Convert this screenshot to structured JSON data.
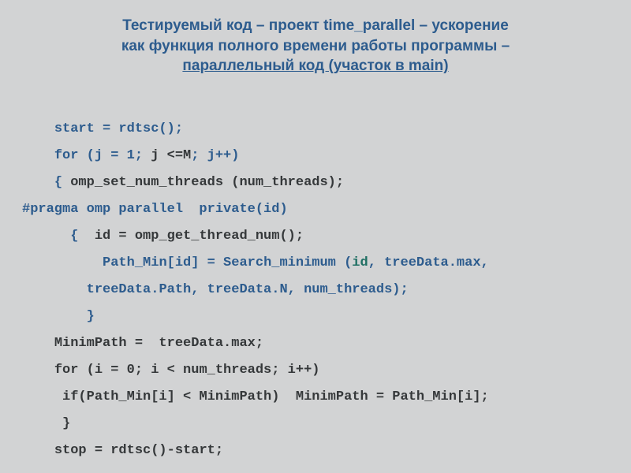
{
  "title": {
    "line1": "Тестируемый код – проект time_parallel – ускорение",
    "line2": "как функция полного времени работы программы –",
    "line3": "параллельный код (участок в main)"
  },
  "code": {
    "in1": "    ",
    "in2": "      ",
    "in3": "        ",
    "in4": "          ",
    "l1a": "start = rdtsc();",
    "l2a": "for (j = 1;",
    "l2b": " j <=M",
    "l2c": "; j++)",
    "l3a": "{",
    "l3b": " omp_set_num_threads (num_threads);",
    "l4a": "#pragma omp parallel  private(id)",
    "l5a": "{ ",
    "l5b": " id = omp_get_thread_num();",
    "l6a": "Path_Min[id] = Search_minimum (",
    "l6b": "id",
    "l6c": ", treeData.max,",
    "l7a": "treeData.Path, treeData.N, num_threads);",
    "l8a": "}",
    "l9a": "MinimPath =  treeData.max;",
    "l10a": "for (i = 0; i < num_threads; i++)",
    "l11a": " if(Path_Min[i] < MinimPath)  MinimPath = Path_Min[i];",
    "l12a": " }",
    "l13a": "stop = rdtsc()-start;"
  }
}
